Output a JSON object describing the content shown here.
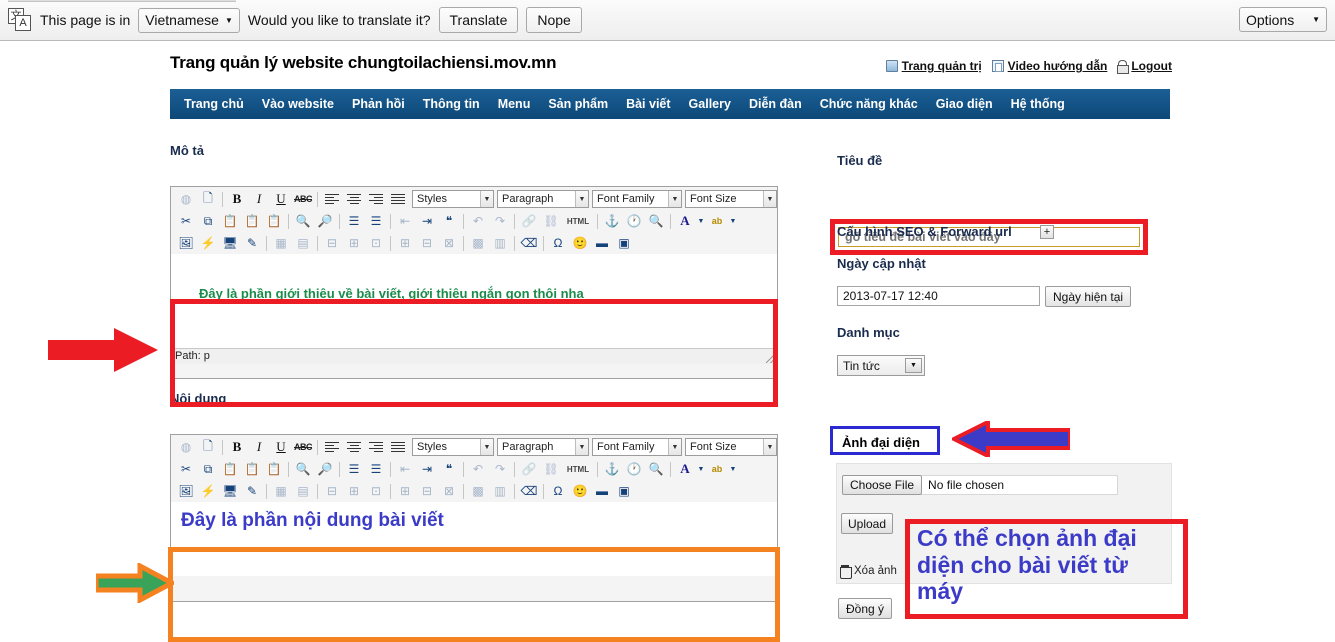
{
  "translate_bar": {
    "icon": "translate-icon",
    "prefix_text": "This page is in",
    "language": "Vietnamese",
    "question_text": "Would you like to translate it?",
    "translate_label": "Translate",
    "nope_label": "Nope",
    "options_label": "Options"
  },
  "header": {
    "site_title": "Trang quản lý website chungtoilachiensi.mov.mn",
    "links": [
      {
        "label": "Trang quản trị",
        "icon": "admin-icon"
      },
      {
        "label": "Video hướng dẫn",
        "icon": "video-icon"
      },
      {
        "label": "Logout",
        "icon": "lock-icon"
      }
    ]
  },
  "nav": {
    "items": [
      "Trang chủ",
      "Vào website",
      "Phản hồi",
      "Thông tin",
      "Menu",
      "Sản phẩm",
      "Bài viết",
      "Gallery",
      "Diễn đàn",
      "Chức năng khác",
      "Giao diện",
      "Hệ thống"
    ]
  },
  "left": {
    "mo_ta_label": "Mô tả",
    "noi_dung_label": "Nội dung",
    "mo_ta_content": "Đây là phần giới thiệu về bài viết, giới thiệu ngắn gọn thôi nha",
    "noi_dung_content": "Đây là phần nội dung bài viết",
    "status_path": "Path: p"
  },
  "editor_toolbar": {
    "selects": [
      {
        "name": "styles",
        "value": "Styles"
      },
      {
        "name": "paragraph",
        "value": "Paragraph"
      },
      {
        "name": "font-family",
        "value": "Font Family"
      },
      {
        "name": "font-size",
        "value": "Font Size"
      }
    ],
    "row1_icons": [
      "reset-icon",
      "new-document-icon",
      "bold-icon",
      "italic-icon",
      "underline-icon",
      "strikethrough-icon",
      "align-left-icon",
      "align-center-icon",
      "align-right-icon",
      "align-justify-icon"
    ],
    "row2_icons": [
      "cut-icon",
      "copy-icon",
      "paste-icon",
      "paste-text-icon",
      "paste-word-icon",
      "find-icon",
      "find-replace-icon",
      "bullet-list-icon",
      "numbered-list-icon",
      "outdent-icon",
      "indent-icon",
      "blockquote-icon",
      "undo-icon",
      "redo-icon",
      "link-icon",
      "unlink-icon",
      "html-icon",
      "anchor-icon",
      "clock-icon",
      "preview-icon",
      "forecolor-icon",
      "backcolor-icon"
    ],
    "row3_icons": [
      "image-icon",
      "flash-icon",
      "media-icon",
      "edit-icon",
      "table-icon",
      "table-props-icon",
      "row-props-icon",
      "row-before-icon",
      "row-after-icon",
      "col-before-icon",
      "col-after-icon",
      "delete-col-icon",
      "cleanup-icon",
      "charmap-icon",
      "emoticon-icon",
      "hr-icon",
      "fullpage-icon"
    ],
    "html_label": "HTML"
  },
  "right": {
    "tieu_de_label": "Tiêu đề",
    "tieu_de_placeholder": "gõ tiêu đề bài viết vào đây",
    "seo_label": "Cấu hình SEO & Forward url",
    "seo_plus": "+",
    "ngay_label": "Ngày cập nhật",
    "ngay_value": "2013-07-17 12:40",
    "ngay_button": "Ngày hiện tại",
    "danh_muc_label": "Danh mục",
    "danh_muc_value": "Tin tức",
    "anh_dai_dien_label": "Ảnh đại diện",
    "choose_file_label": "Choose File",
    "no_file_chosen": "No file chosen",
    "upload_label": "Upload",
    "xoa_anh_label": "Xóa ảnh",
    "dong_y_label": "Đồng ý",
    "note_text": "Có thể chọn ảnh đại diện cho bài viết từ máy"
  },
  "annotations": {
    "arrow_red": "red-arrow-right",
    "arrow_green": "green-arrow-right",
    "arrow_blue": "blue-arrow-left"
  },
  "colors": {
    "nav_blue": "#0d4878",
    "highlight_red": "#ec1c24",
    "highlight_orange": "#f58220",
    "highlight_blue": "#2a2ad0",
    "text_green": "#1a8c4a",
    "text_blue": "#3b3bc8"
  }
}
